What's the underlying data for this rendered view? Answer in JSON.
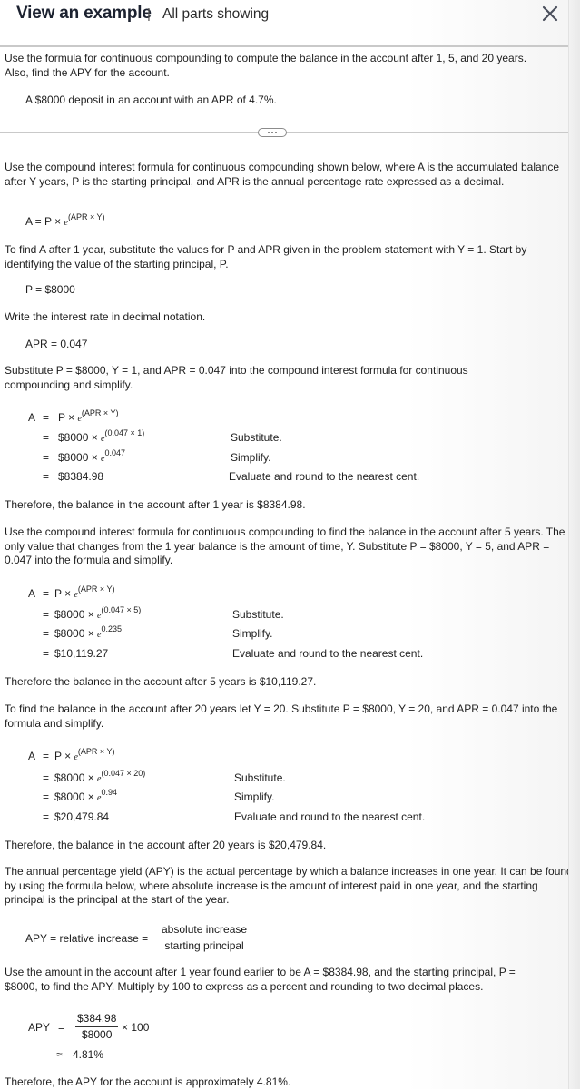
{
  "header": {
    "title": "View an example",
    "separator": "|",
    "subtitle": "All parts showing",
    "close_icon": "close-x-icon"
  },
  "problem": {
    "prompt": "Use the formula for continuous compounding to compute the balance in the account after 1, 5, and 20 years. Also, find the APY for the account.",
    "given": "A $8000 deposit in an account with an APR of 4.7%."
  },
  "expand_button": {
    "icon": "ellipsis-icon",
    "label": "..."
  },
  "solution": {
    "intro": "Use the compound interest formula for continuous compounding shown below, where A is the accumulated balance after Y years, P is the starting principal, and APR is the annual percentage rate expressed as a decimal.",
    "formula": {
      "lhs": "A = P × ",
      "base": "e",
      "exp": "(APR × Y)"
    },
    "step1_text": "To find A after 1 year, substitute the values for P and APR given in the problem statement with Y = 1. Start by identifying the value of the starting principal, P.",
    "principal": "P = $8000",
    "rate_text": "Write the interest rate in decimal notation.",
    "rate": "APR = 0.047",
    "sub1_text": "Substitute P = $8000, Y = 1, and APR = 0.047 into the compound interest formula for continuous compounding and simplify.",
    "year1": {
      "A": "A",
      "eq": "=",
      "line0": {
        "pre": "P × ",
        "base": "e",
        "exp": "(APR × Y)"
      },
      "line1": {
        "pre": "$8000 × ",
        "base": "e",
        "exp": "(0.047 × 1)",
        "note": "Substitute."
      },
      "line2": {
        "pre": "$8000 × ",
        "base": "e",
        "exp": "0.047",
        "note": "Simplify."
      },
      "line3": {
        "pre": "$8384.98",
        "note": "Evaluate and round to the nearest cent."
      }
    },
    "result1": "Therefore, the balance in the account after 1 year is $8384.98.",
    "sub5_text": "Use the compound interest formula for continuous compounding to find the balance in the account after 5 years. The only value that changes from the 1 year balance is the amount of time, Y. Substitute P = $8000, Y = 5, and APR = 0.047 into the formula and simplify.",
    "year5": {
      "A": "A",
      "eq": "=",
      "line0": {
        "pre": "P × ",
        "base": "e",
        "exp": "(APR × Y)"
      },
      "line1": {
        "pre": "$8000 × ",
        "base": "e",
        "exp": "(0.047 × 5)",
        "note": "Substitute."
      },
      "line2": {
        "pre": "$8000 × ",
        "base": "e",
        "exp": "0.235",
        "note": "Simplify."
      },
      "line3": {
        "pre": "$10,119.27",
        "note": "Evaluate and round to the nearest cent."
      }
    },
    "result5": "Therefore the balance in the account after 5 years is $10,119.27.",
    "sub20_text": "To find the balance in the account after 20 years let Y = 20. Substitute P = $8000, Y = 20, and APR = 0.047 into the formula and simplify.",
    "year20": {
      "A": "A",
      "eq": "=",
      "line0": {
        "pre": "P × ",
        "base": "e",
        "exp": "(APR × Y)"
      },
      "line1": {
        "pre": "$8000 × ",
        "base": "e",
        "exp": "(0.047 × 20)",
        "note": "Substitute."
      },
      "line2": {
        "pre": "$8000 × ",
        "base": "e",
        "exp": "0.94",
        "note": "Simplify."
      },
      "line3": {
        "pre": "$20,479.84",
        "note": "Evaluate and round to the nearest cent."
      }
    },
    "result20": "Therefore, the balance in the account after 20 years is $20,479.84.",
    "apy_text": "The annual percentage yield (APY) is the actual percentage by which a balance increases in one year. It can be found by using the formula below, where absolute increase is the amount of interest paid in one year, and the starting principal is the principal at the start of the year.",
    "apy_formula": {
      "lhs": "APY = relative increase =",
      "num": "absolute increase",
      "den": "starting principal"
    },
    "apy_sub_text": "Use the amount in the account after 1 year found earlier to be A = $8384.98, and the starting principal, P = $8000, to find the APY. Multiply by 100 to express as a percent and rounding to two decimal places.",
    "apy_calc": {
      "lhs": "APY",
      "eq": "=",
      "num": "$384.98",
      "den": "$8000",
      "mult": "× 100",
      "approx": "≈",
      "result": "4.81%"
    },
    "apy_result": "Therefore, the APY for the account is approximately 4.81%."
  }
}
